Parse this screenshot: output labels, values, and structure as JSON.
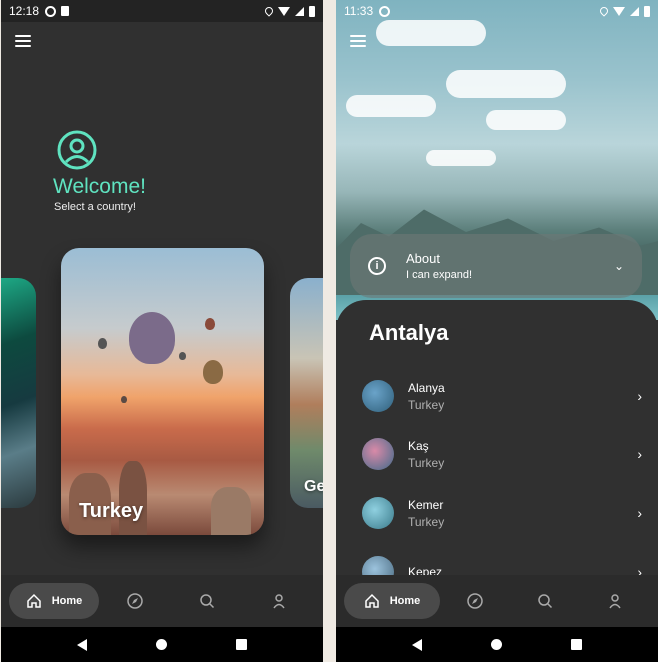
{
  "left_screen": {
    "status": {
      "time": "12:18"
    },
    "welcome": {
      "title": "Welcome!",
      "subtitle": "Select a country!"
    },
    "cards": {
      "main_label": "Turkey",
      "right_label": "Ge"
    },
    "nav": {
      "home_label": "Home"
    }
  },
  "right_screen": {
    "status": {
      "time": "11:33"
    },
    "about": {
      "title": "About",
      "subtitle": "I can expand!"
    },
    "sheet_title": "Antalya",
    "cities": [
      {
        "name": "Alanya",
        "country": "Turkey"
      },
      {
        "name": "Kaş",
        "country": "Turkey"
      },
      {
        "name": "Kemer",
        "country": "Turkey"
      },
      {
        "name": "Kepez"
      }
    ],
    "nav": {
      "home_label": "Home"
    }
  },
  "colors": {
    "accent": "#5fe3c0",
    "background": "#303030",
    "nav_pill": "#4a4a4a"
  },
  "icons": [
    "menu-icon",
    "account-circle-icon",
    "home-icon",
    "compass-icon",
    "search-icon",
    "person-icon",
    "info-icon",
    "chevron-down-icon",
    "chevron-right-icon"
  ]
}
